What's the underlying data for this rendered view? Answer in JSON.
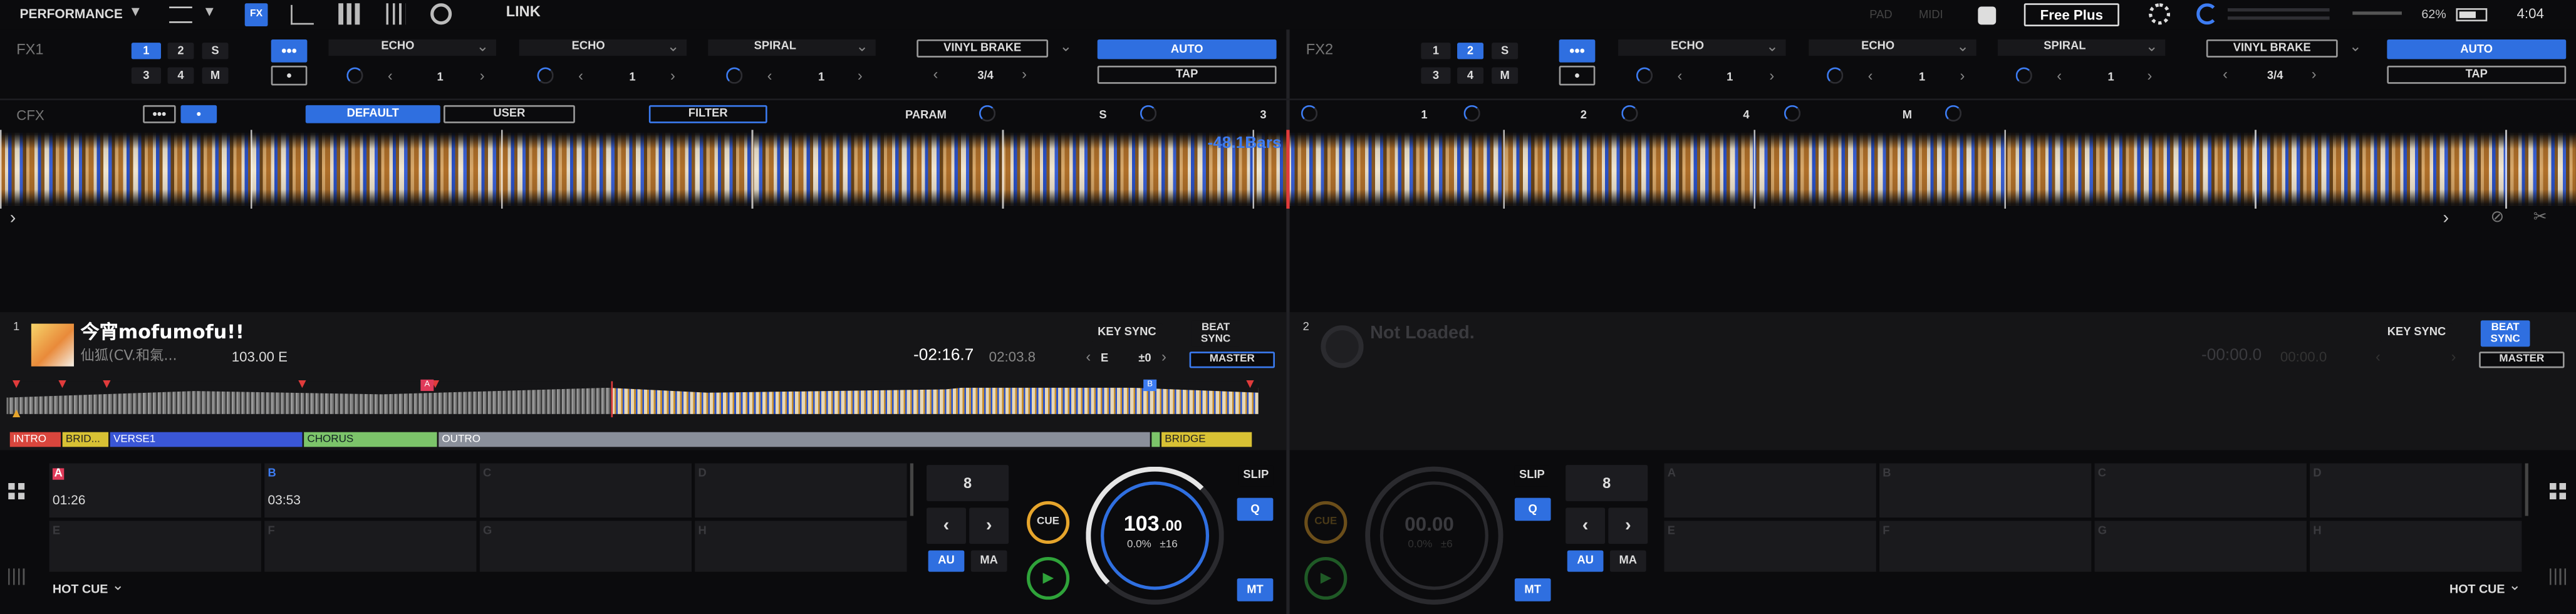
{
  "top": {
    "layout": "PERFORMANCE",
    "link": "LINK",
    "pad": "PAD",
    "midi": "MIDI",
    "plan": "Free Plus",
    "battery": "62%",
    "time": "4:04"
  },
  "fx1": {
    "label": "FX1",
    "slots": [
      "1",
      "2",
      "S",
      "3",
      "4",
      "M"
    ],
    "fx": [
      {
        "name": "ECHO",
        "beat": "1"
      },
      {
        "name": "ECHO",
        "beat": "1"
      },
      {
        "name": "SPIRAL",
        "beat": "1"
      }
    ],
    "brake": "VINYL BRAKE",
    "brake_beat": "3/4",
    "auto": "AUTO",
    "tap": "TAP"
  },
  "fx2": {
    "label": "FX2",
    "slots": [
      "1",
      "2",
      "S",
      "3",
      "4",
      "M"
    ],
    "fx": [
      {
        "name": "ECHO",
        "beat": "1"
      },
      {
        "name": "ECHO",
        "beat": "1"
      },
      {
        "name": "SPIRAL",
        "beat": "1"
      }
    ],
    "brake": "VINYL BRAKE",
    "brake_beat": "3/4",
    "auto": "AUTO",
    "tap": "TAP"
  },
  "cfx": {
    "label": "CFX",
    "default": "DEFAULT",
    "user": "USER",
    "filter": "FILTER",
    "param": "PARAM",
    "knobs": [
      "S",
      "3",
      "1",
      "2",
      "4",
      "M"
    ]
  },
  "wave": {
    "bars": "-48.1Bars"
  },
  "deck1": {
    "num": "1",
    "title": "今宵mofumofu!!",
    "artist": "仙狐(CV.和氣...",
    "bpm_key": "103.00  E",
    "remain": "-02:16.7",
    "total": "02:03.8",
    "key_sync": "KEY SYNC",
    "key": "E",
    "key_offset": "±0",
    "beat_sync": "BEAT SYNC",
    "master": "MASTER",
    "sections": [
      "INTRO",
      "BRID...",
      "VERSE1",
      "CHORUS",
      "OUTRO",
      "BRIDGE"
    ],
    "pads": [
      {
        "letter": "A",
        "time": "01:26"
      },
      {
        "letter": "B",
        "time": "03:53"
      },
      {
        "letter": "C",
        "time": ""
      },
      {
        "letter": "D",
        "time": ""
      },
      {
        "letter": "E",
        "time": ""
      },
      {
        "letter": "F",
        "time": ""
      },
      {
        "letter": "G",
        "time": ""
      },
      {
        "letter": "H",
        "time": ""
      }
    ],
    "mode": "HOT CUE",
    "loop": "8",
    "au": "AU",
    "ma": "MA",
    "cue": "CUE",
    "slip": "SLIP",
    "q": "Q",
    "mt": "MT",
    "bpm_big": "103",
    "bpm_dec": ".00",
    "pitch": "0.0%",
    "range": "±16"
  },
  "deck2": {
    "num": "2",
    "title": "Not Loaded.",
    "remain": "-00:00.0",
    "total": "00:00.0",
    "key_sync": "KEY SYNC",
    "beat_sync": "BEAT SYNC",
    "master": "MASTER",
    "pads": [
      {
        "letter": "A"
      },
      {
        "letter": "B"
      },
      {
        "letter": "C"
      },
      {
        "letter": "D"
      },
      {
        "letter": "E"
      },
      {
        "letter": "F"
      },
      {
        "letter": "G"
      },
      {
        "letter": "H"
      }
    ],
    "mode": "HOT CUE",
    "loop": "8",
    "au": "AU",
    "ma": "MA",
    "cue": "CUE",
    "slip": "SLIP",
    "q": "Q",
    "mt": "MT",
    "bpm_big": "00.00",
    "pitch": "0.0%",
    "range": "±6"
  },
  "colors": {
    "accent": "#2f6fe0",
    "cue": "#e6a52c",
    "play": "#2fa33a",
    "intro": "#d9463d",
    "bridge": "#d8c134",
    "verse": "#3a56d6",
    "chorus": "#7cc46a",
    "outro": "#8a8f9a"
  }
}
